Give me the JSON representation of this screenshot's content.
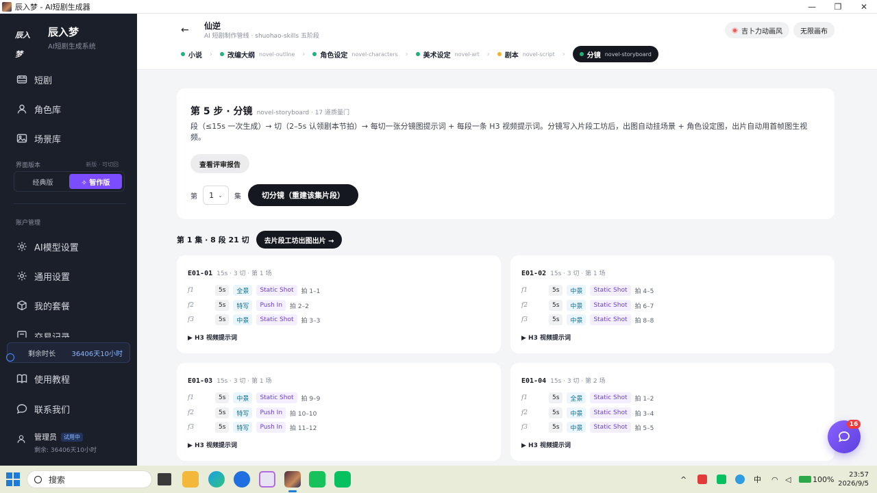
{
  "window": {
    "title": "辰入梦 - AI短剧生成器",
    "controls": [
      "—",
      "❐",
      "✕"
    ]
  },
  "sidebar": {
    "brand": {
      "logo": "辰入梦",
      "name": "辰入梦",
      "subtitle": "AI短剧生成系统"
    },
    "nav_top": [
      {
        "label": "短剧",
        "icon": "film-icon"
      },
      {
        "label": "角色库",
        "icon": "user-icon"
      },
      {
        "label": "场景库",
        "icon": "image-icon"
      }
    ],
    "version": {
      "label": "界面版本",
      "hint": "新版 · 可切回",
      "options": [
        "经典版",
        "✧ 智作版"
      ],
      "active_index": 1
    },
    "account_label": "账户管理",
    "nav_account": [
      {
        "label": "AI模型设置",
        "icon": "gear-icon"
      },
      {
        "label": "通用设置",
        "icon": "gear-icon"
      },
      {
        "label": "我的套餐",
        "icon": "box-icon"
      },
      {
        "label": "交易记录",
        "icon": "receipt-icon"
      }
    ],
    "remaining": {
      "label": "剩余时长",
      "value": "36406天10小时"
    },
    "nav_bottom": [
      {
        "label": "使用教程",
        "icon": "book-icon"
      },
      {
        "label": "联系我们",
        "icon": "chat-icon"
      }
    ],
    "user": {
      "name": "管理员",
      "badge": "试用中",
      "remaining": "剩余: 36406天10小时"
    }
  },
  "header": {
    "back": "←",
    "title": "仙逆",
    "subtitle": "AI 短剧制作管线 · shuohao-skills 五阶段",
    "style_button": "吉卜力动画风",
    "canvas_button": "无限画布",
    "steps": [
      {
        "label": "小说",
        "en": "",
        "color": "#1fb37a"
      },
      {
        "label": "改编大纲",
        "en": "novel-outline",
        "color": "#1fb37a"
      },
      {
        "label": "角色设定",
        "en": "novel-characters",
        "color": "#1fb37a"
      },
      {
        "label": "美术设定",
        "en": "novel-art",
        "color": "#1fb37a"
      },
      {
        "label": "剧本",
        "en": "novel-script",
        "color": "#f0b429"
      },
      {
        "label": "分镜",
        "en": "novel-storyboard",
        "color": "#1fb37a"
      }
    ],
    "active_step": 5
  },
  "step_card": {
    "title": "第 5 步 · 分镜",
    "meta": "novel-storyboard · 17 道质量门",
    "description": "段（≤15s 一次生成）→ 切（2–5s 认领剧本节拍）→ 每切一张分镜图提示词 + 每段一条 H3 视频提示词。分镜写入片段工坊后，出图自动挂场景 + 角色设定图，出片自动用首帧图生视频。",
    "review_button": "查看评审报告",
    "episode_prefix": "第",
    "episode_value": "1",
    "episode_suffix": "集",
    "cut_button": "切分镜（重建该集片段）"
  },
  "summary": {
    "text": "第 1 集 · 8 段 21 切",
    "go_button": "去片段工坊出图出片 →"
  },
  "segments": [
    {
      "id": "E01-01",
      "meta": "15s · 3 切 · 第 1 场",
      "frames": [
        {
          "idx": "f1",
          "dur": "5s",
          "shot": "全景",
          "cam": "Static Shot",
          "beat": "拍 1–1"
        },
        {
          "idx": "f2",
          "dur": "5s",
          "shot": "特写",
          "cam": "Push In",
          "beat": "拍 2–2"
        },
        {
          "idx": "f3",
          "dur": "5s",
          "shot": "中景",
          "cam": "Static Shot",
          "beat": "拍 3–3"
        }
      ],
      "h3": "▶ H3 视频提示词"
    },
    {
      "id": "E01-02",
      "meta": "15s · 3 切 · 第 1 场",
      "frames": [
        {
          "idx": "f1",
          "dur": "5s",
          "shot": "中景",
          "cam": "Static Shot",
          "beat": "拍 4–5"
        },
        {
          "idx": "f2",
          "dur": "5s",
          "shot": "中景",
          "cam": "Static Shot",
          "beat": "拍 6–7"
        },
        {
          "idx": "f3",
          "dur": "5s",
          "shot": "中景",
          "cam": "Static Shot",
          "beat": "拍 8–8"
        }
      ],
      "h3": "▶ H3 视频提示词"
    },
    {
      "id": "E01-03",
      "meta": "15s · 3 切 · 第 1 场",
      "frames": [
        {
          "idx": "f1",
          "dur": "5s",
          "shot": "中景",
          "cam": "Static Shot",
          "beat": "拍 9–9"
        },
        {
          "idx": "f2",
          "dur": "5s",
          "shot": "特写",
          "cam": "Push In",
          "beat": "拍 10–10"
        },
        {
          "idx": "f3",
          "dur": "5s",
          "shot": "特写",
          "cam": "Push In",
          "beat": "拍 11–12"
        }
      ],
      "h3": "▶ H3 视频提示词"
    },
    {
      "id": "E01-04",
      "meta": "15s · 3 切 · 第 2 场",
      "frames": [
        {
          "idx": "f1",
          "dur": "5s",
          "shot": "全景",
          "cam": "Static Shot",
          "beat": "拍 1–2"
        },
        {
          "idx": "f2",
          "dur": "5s",
          "shot": "中景",
          "cam": "Static Shot",
          "beat": "拍 3–4"
        },
        {
          "idx": "f3",
          "dur": "5s",
          "shot": "中景",
          "cam": "Static Shot",
          "beat": "拍 5–5"
        }
      ],
      "h3": "▶ H3 视频提示词"
    }
  ],
  "fab": {
    "badge": "16"
  },
  "taskbar": {
    "search_placeholder": "搜索",
    "tray_lang": "中",
    "battery": "100%",
    "time": "23:57",
    "date": "2026/9/5"
  }
}
